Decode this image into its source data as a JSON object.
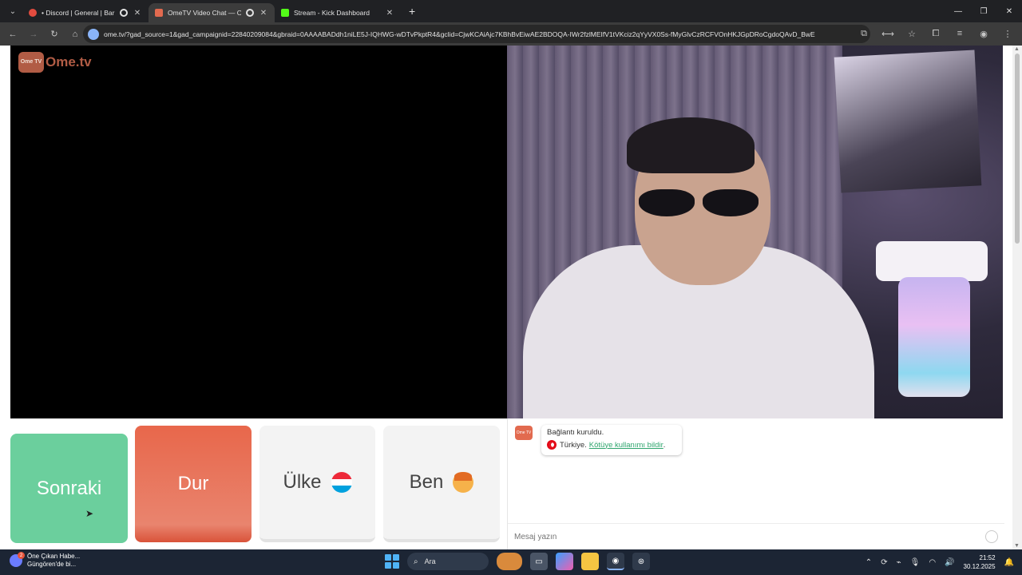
{
  "browser": {
    "tabs": [
      {
        "title": "• Discord | General | Barış Ö",
        "favicon_color": "#e34c3f",
        "active": false
      },
      {
        "title": "OmeTV Video Chat — Ome",
        "favicon_color": "#e26a4f",
        "active": true
      },
      {
        "title": "Stream - Kick Dashboard",
        "favicon_color": "#53fc18",
        "active": false
      }
    ],
    "url": "ome.tv/?gad_source=1&gad_campaignid=22840209084&gbraid=0AAAABADdh1niLE5J-IQHWG-wDTvPkptR4&gclid=CjwKCAiAjc7KBhBvEiwAE2BDOQA-IWr2fzlMEIfV1tVKciz2qYyVX0Ss-fMyGlvCzRCFVOnHKJGpDRoCgdoQAvD_BwE"
  },
  "app": {
    "logo_top": "Ome TV",
    "logo_text": "Ome.tv"
  },
  "controls": {
    "next_label": "Sonraki",
    "stop_label": "Dur",
    "country_label": "Ülke",
    "me_label": "Ben",
    "next_color": "#6bcf9d",
    "stop_color": "#e8674b"
  },
  "chat": {
    "status_message": "Bağlantı kuruldu.",
    "country": "Türkiye.",
    "report_link": "Kötüye kullanımı bildir",
    "report_suffix": ".",
    "input_placeholder": "Mesaj yazın"
  },
  "taskbar": {
    "news_badge": "2",
    "news_line1": "Öne Çıkan Habe...",
    "news_line2": "Güngören'de bi...",
    "search_placeholder": "Ara",
    "time": "21:52",
    "date": "30.12.2025"
  }
}
